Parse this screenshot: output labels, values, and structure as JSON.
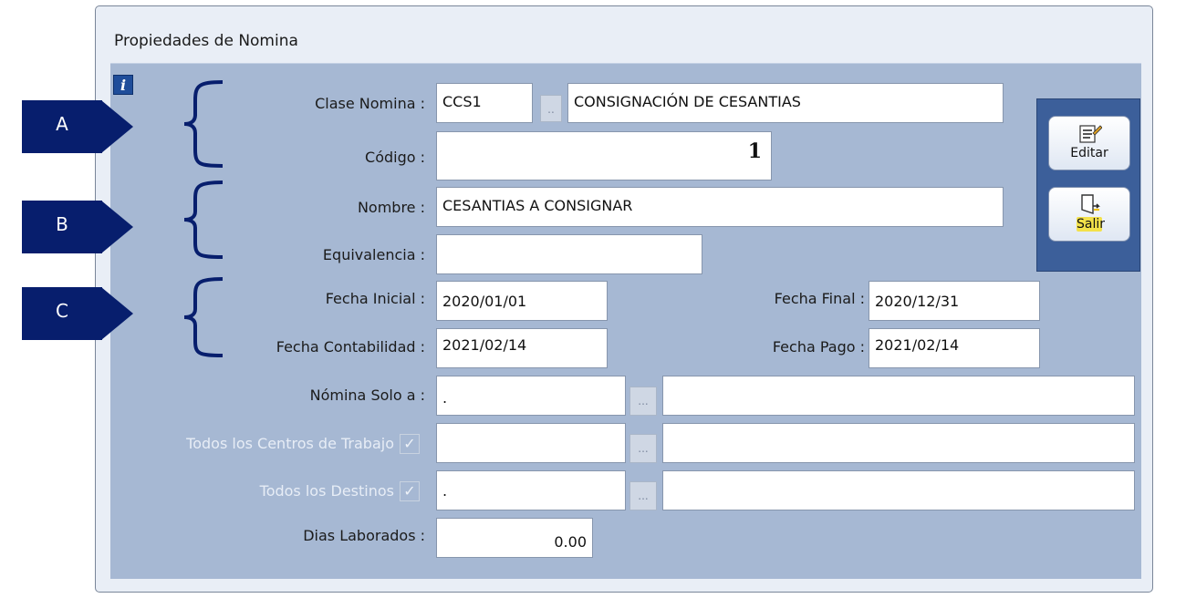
{
  "window": {
    "title": "Propiedades de Nomina"
  },
  "info_icon": {
    "glyph": "i"
  },
  "callouts": [
    "A",
    "B",
    "C"
  ],
  "form": {
    "clase_nomina": {
      "label": "Clase Nomina :",
      "code": "CCS1",
      "lookup": "..",
      "description": "CONSIGNACIÓN DE CESANTIAS"
    },
    "codigo": {
      "label": "Código :",
      "value": "1"
    },
    "nombre": {
      "label": "Nombre :",
      "value": "CESANTIAS A CONSIGNAR"
    },
    "equivalencia": {
      "label": "Equivalencia :",
      "value": ""
    },
    "fecha_inicial": {
      "label": "Fecha Inicial :",
      "value": "2020/01/01"
    },
    "fecha_final": {
      "label": "Fecha Final :",
      "value": "2020/12/31"
    },
    "fecha_contabilidad": {
      "label": "Fecha Contabilidad :",
      "value": "2021/02/14"
    },
    "fecha_pago": {
      "label": "Fecha Pago :",
      "value": "2021/02/14"
    },
    "nomina_solo_a": {
      "label": "Nómina Solo a :",
      "code": ".",
      "lookup": "...",
      "description": ""
    },
    "centros_trabajo": {
      "label": "Todos los Centros de Trabajo",
      "checked": true,
      "check_glyph": "✓",
      "code": "",
      "lookup": "...",
      "description": ""
    },
    "destinos": {
      "label": "Todos los Destinos",
      "checked": true,
      "check_glyph": "✓",
      "code": ".",
      "lookup": "...",
      "description": ""
    },
    "dias_laborados": {
      "label": "Dias Laborados :",
      "value": "0.00"
    }
  },
  "toolbar": {
    "edit_label": "Editar",
    "exit_label": "Salir"
  },
  "colors": {
    "panel": "#a6b8d3",
    "callout": "#071e6d",
    "toolbar": "#3c5f9a"
  }
}
